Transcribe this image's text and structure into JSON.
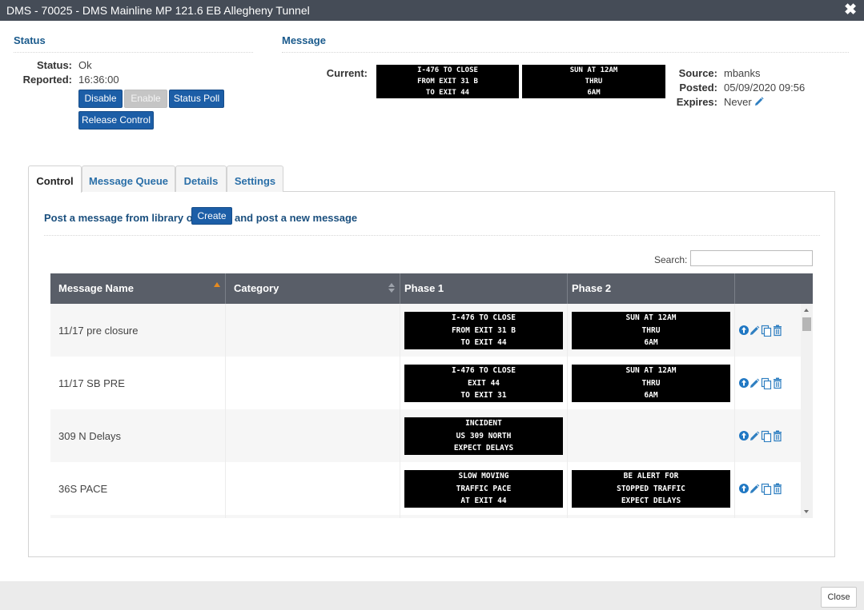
{
  "window": {
    "title": "DMS - 70025 - DMS Mainline MP 121.6 EB Allegheny Tunnel"
  },
  "status": {
    "heading": "Status",
    "status_label": "Status:",
    "status_value": "Ok",
    "reported_label": "Reported:",
    "reported_value": "16:36:00",
    "buttons": {
      "disable": "Disable",
      "enable": "Enable",
      "status_poll": "Status Poll",
      "release_control": "Release Control"
    }
  },
  "message": {
    "heading": "Message",
    "current_label": "Current:",
    "current_phase1": [
      "I-476 TO CLOSE",
      "FROM EXIT 31 B",
      "TO EXIT 44"
    ],
    "current_phase2": [
      "SUN AT 12AM",
      "THRU",
      "6AM"
    ],
    "source_label": "Source:",
    "source_value": "mbanks",
    "posted_label": "Posted:",
    "posted_value": "05/09/2020 09:56",
    "expires_label": "Expires:",
    "expires_value": "Never"
  },
  "tabs": [
    {
      "label": "Control",
      "active": true
    },
    {
      "label": "Message Queue",
      "active": false
    },
    {
      "label": "Details",
      "active": false
    },
    {
      "label": "Settings",
      "active": false
    }
  ],
  "control": {
    "post_prefix": "Post a message from library or",
    "create_label": "Create",
    "post_suffix": "and post a new message",
    "search_label": "Search:",
    "search_value": ""
  },
  "table": {
    "columns": [
      "Message Name",
      "Category",
      "Phase 1",
      "Phase 2"
    ],
    "rows": [
      {
        "name": "11/17 pre closure",
        "category": "",
        "phase1": [
          "I-476 TO CLOSE",
          "FROM EXIT 31 B",
          "TO EXIT 44"
        ],
        "phase2": [
          "SUN AT 12AM",
          "THRU",
          "6AM"
        ]
      },
      {
        "name": "11/17 SB PRE",
        "category": "",
        "phase1": [
          "I-476 TO CLOSE",
          "EXIT 44",
          "TO EXIT 31"
        ],
        "phase2": [
          "SUN AT 12AM",
          "THRU",
          "6AM"
        ]
      },
      {
        "name": "309 N Delays",
        "category": "",
        "phase1": [
          "INCIDENT",
          "US 309 NORTH",
          "EXPECT DELAYS"
        ],
        "phase2": []
      },
      {
        "name": "36S PACE",
        "category": "",
        "phase1": [
          "SLOW MOVING",
          "TRAFFIC PACE",
          "AT EXIT 44"
        ],
        "phase2": [
          "BE ALERT FOR",
          "STOPPED TRAFFIC",
          "EXPECT DELAYS"
        ]
      }
    ]
  },
  "footer": {
    "close_label": "Close"
  },
  "colors": {
    "titlebar": "#454c57",
    "primary_button": "#1c5ea7",
    "heading": "#1a5a8c",
    "grid_header": "#595e68",
    "sort_indicator": "#e58a1f"
  }
}
